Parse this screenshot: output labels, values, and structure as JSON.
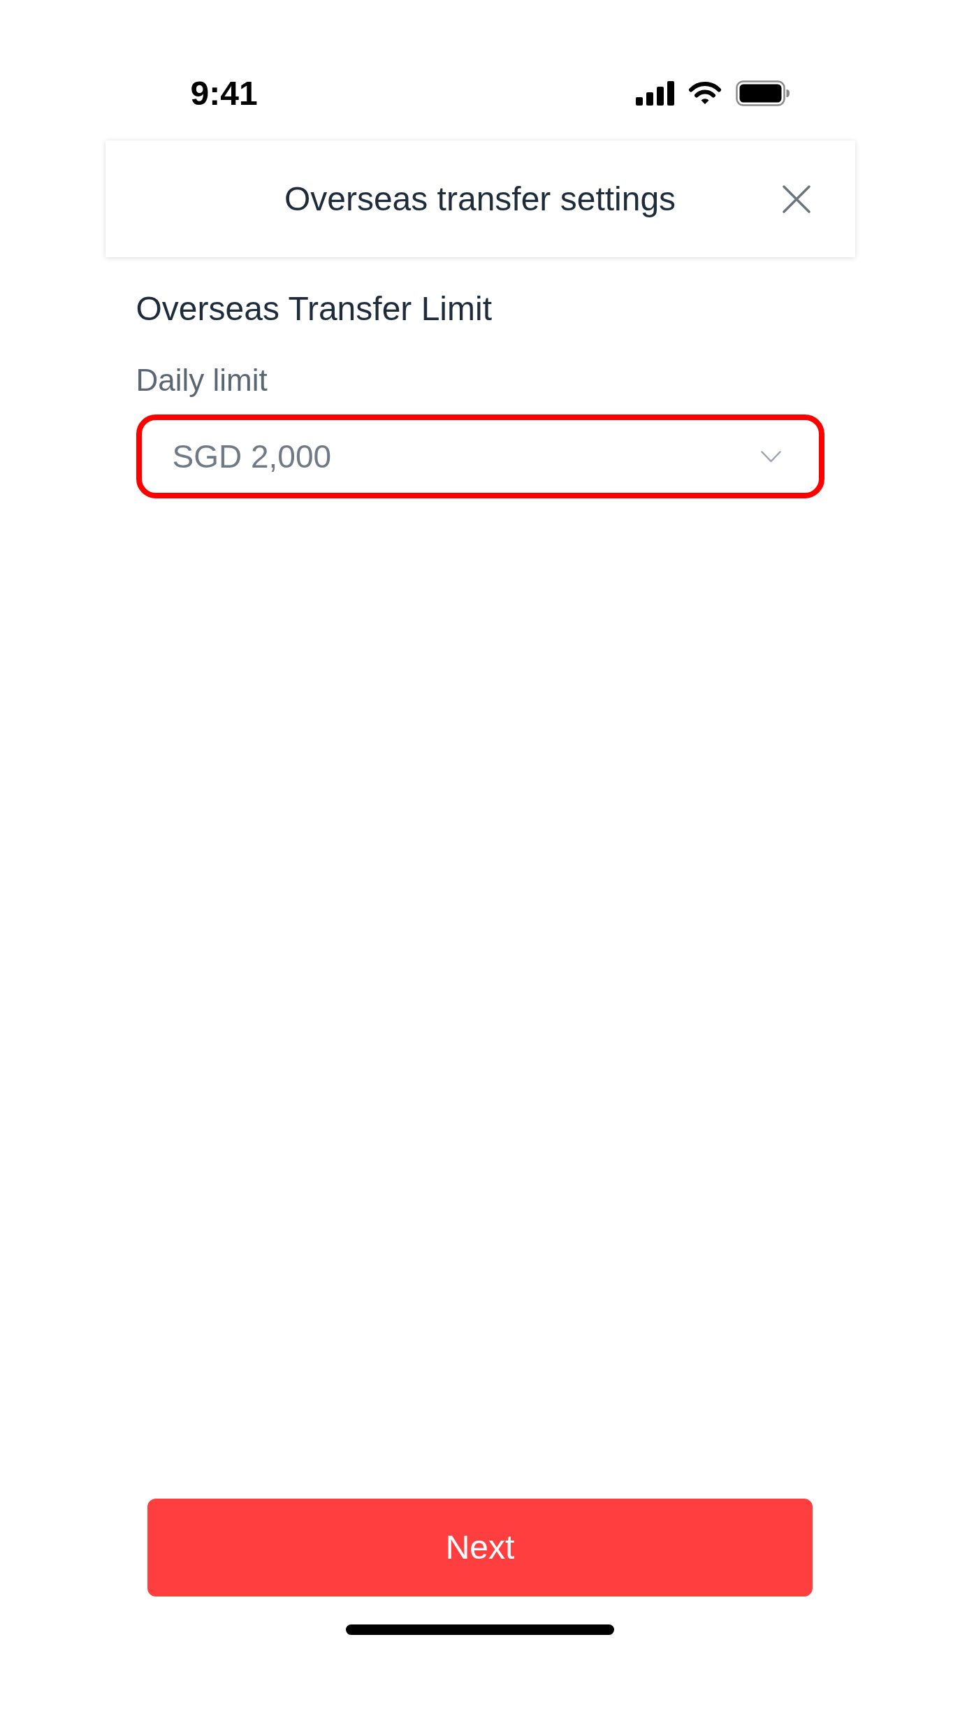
{
  "status_bar": {
    "time": "9:41"
  },
  "header": {
    "title": "Overseas transfer settings"
  },
  "section": {
    "title": "Overseas Transfer Limit"
  },
  "daily_limit": {
    "label": "Daily limit",
    "value": "SGD 2,000",
    "highlighted": true
  },
  "buttons": [
    {
      "label": "Next"
    }
  ]
}
